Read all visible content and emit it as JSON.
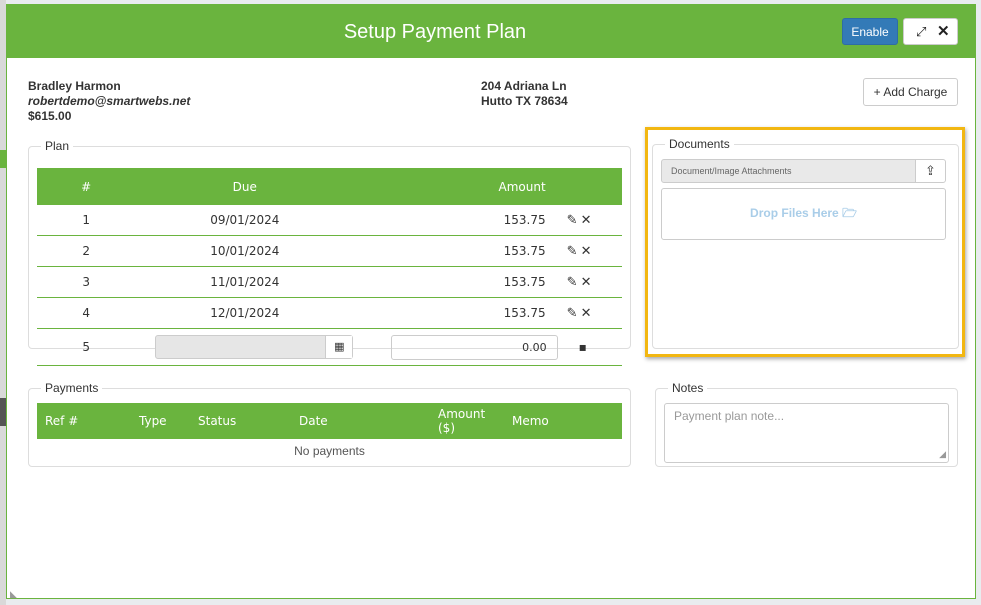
{
  "header": {
    "title": "Setup Payment Plan",
    "enable_label": "Enable",
    "expand_glyph": "⤢",
    "close_glyph": "✕"
  },
  "customer": {
    "name": "Bradley Harmon",
    "email": "robertdemo@smartwebs.net",
    "balance": "$615.00"
  },
  "address": {
    "line1": "204 Adriana Ln",
    "line2": "Hutto TX 78634"
  },
  "add_charge": {
    "plus": "+",
    "label": "Add Charge"
  },
  "plan": {
    "legend": "Plan",
    "columns": [
      "#",
      "Due",
      "Amount"
    ],
    "rows": [
      {
        "num": "1",
        "due": "09/01/2024",
        "amount": "153.75"
      },
      {
        "num": "2",
        "due": "10/01/2024",
        "amount": "153.75"
      },
      {
        "num": "3",
        "due": "11/01/2024",
        "amount": "153.75"
      },
      {
        "num": "4",
        "due": "12/01/2024",
        "amount": "153.75"
      }
    ],
    "new_row": {
      "num": "5",
      "due_value": "",
      "amount_value": "0.00"
    },
    "icons": {
      "edit": "✎",
      "delete": "✕",
      "calendar": "▦",
      "save": "▪"
    }
  },
  "payments": {
    "legend": "Payments",
    "columns": [
      "Ref #",
      "Type",
      "Status",
      "Date",
      "Amount ($)",
      "Memo"
    ],
    "empty_text": "No payments"
  },
  "documents": {
    "legend": "Documents",
    "attach_label": "Document/Image Attachments",
    "upload_glyph": "⇪",
    "dropzone_text": "Drop Files Here",
    "folder_glyph": "🗁"
  },
  "notes": {
    "legend": "Notes",
    "placeholder": "Payment plan note..."
  },
  "colors": {
    "header_green": "#6ab43e",
    "enable_blue": "#337ab7",
    "highlight": "#f2b712"
  }
}
